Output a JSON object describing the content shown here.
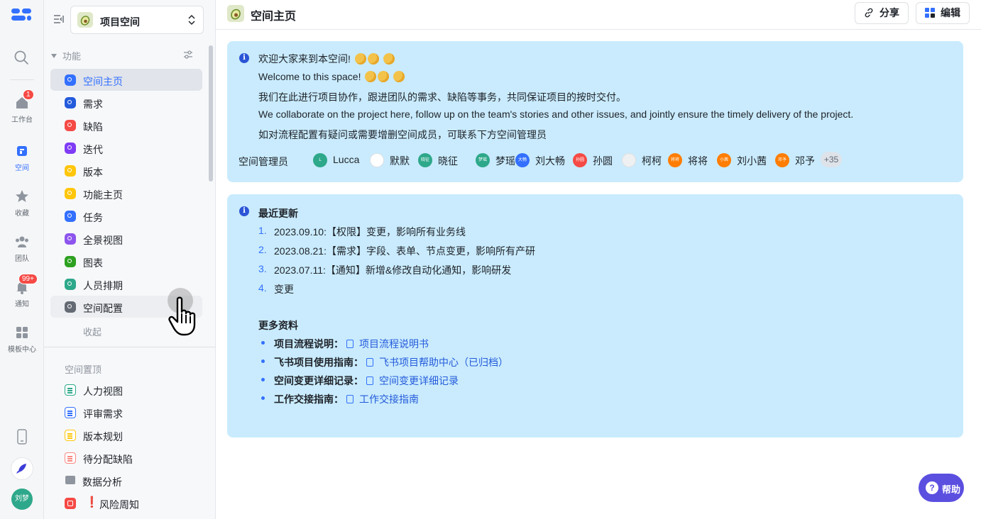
{
  "rail": {
    "items": [
      {
        "label": "工作台",
        "badge": "1"
      },
      {
        "label": "空间"
      },
      {
        "label": "收藏"
      },
      {
        "label": "团队"
      },
      {
        "label": "通知",
        "badge": "99+"
      },
      {
        "label": "模板中心"
      }
    ],
    "user_avatar": "刘梦"
  },
  "sidebar": {
    "space_name": "项目空间",
    "section_features": "功能",
    "items": [
      {
        "label": "空间主页",
        "color": "#3370ff"
      },
      {
        "label": "需求",
        "color": "#245bdb"
      },
      {
        "label": "缺陷",
        "color": "#f54a45"
      },
      {
        "label": "迭代",
        "color": "#7f3bf5"
      },
      {
        "label": "版本",
        "color": "#ffc60a"
      },
      {
        "label": "功能主页",
        "color": "#ffc60a"
      },
      {
        "label": "任务",
        "color": "#3370ff"
      },
      {
        "label": "全景视图",
        "color": "#8d55ed"
      },
      {
        "label": "图表",
        "color": "#2ea121"
      },
      {
        "label": "人员排期",
        "color": "#2ea88a"
      },
      {
        "label": "空间配置",
        "color": "#646a73"
      }
    ],
    "collapse": "收起",
    "section_pinned": "空间置顶",
    "pinned": [
      {
        "label": "人力视图",
        "color": "#2ea88a"
      },
      {
        "label": "评审需求",
        "color": "#3370ff"
      },
      {
        "label": "版本规划",
        "color": "#ffc60a"
      },
      {
        "label": "待分配缺陷",
        "color": "#f98981"
      }
    ],
    "data_analysis": "数据分析",
    "risk_bang": "❗",
    "risk": "风险周知"
  },
  "header": {
    "title": "空间主页",
    "share": "分享",
    "edit": "编辑"
  },
  "welcome": {
    "line1": "欢迎大家来到本空间!",
    "line2": "Welcome to this space!",
    "line3": "我们在此进行项目协作，跟进团队的需求、缺陷等事务，共同保证项目的按时交付。",
    "line4": "We collaborate on the project here, follow up on the team's stories and other issues, and jointly ensure the timely delivery of the project.",
    "line5": "如对流程配置有疑问或需要增删空间成员，可联系下方空间管理员",
    "admins_label": "空间管理员",
    "admins": [
      {
        "name": "Lucca",
        "initial": "L",
        "color": "#2ea88a"
      },
      {
        "name": "默默",
        "initial": "",
        "color": "#ffffff"
      },
      {
        "name": "晓征",
        "initial": "晓征",
        "color": "#2ea88a"
      },
      {
        "name": "梦瑶",
        "initial": "梦瑶",
        "color": "#2ea88a"
      },
      {
        "name": "刘大畅",
        "initial": "大畅",
        "color": "#3370ff"
      },
      {
        "name": "孙圆",
        "initial": "孙圆",
        "color": "#f54a45"
      },
      {
        "name": "柯柯",
        "initial": "",
        "color": "#eef0f2"
      },
      {
        "name": "将将",
        "initial": "将将",
        "color": "#ff7d00"
      },
      {
        "name": "刘小茜",
        "initial": "小茜",
        "color": "#ff7d00"
      },
      {
        "name": "邓予",
        "initial": "邓予",
        "color": "#ff7d00"
      }
    ],
    "admins_more": "+35"
  },
  "updates": {
    "title": "最近更新",
    "items": [
      {
        "num": "1.",
        "text": "2023.09.10:【权限】变更，影响所有业务线"
      },
      {
        "num": "2.",
        "text": "2023.08.21:【需求】字段、表单、节点变更，影响所有产研"
      },
      {
        "num": "3.",
        "text": "2023.07.11:【通知】新增&修改自动化通知，影响研发"
      },
      {
        "num": "4.",
        "text": "变更"
      }
    ],
    "more_title": "更多资料",
    "links": [
      {
        "label": "项目流程说明：",
        "link": "项目流程说明书"
      },
      {
        "label": "飞书项目使用指南：",
        "link": "飞书项目帮助中心（已归档）"
      },
      {
        "label": "空间变更详细记录：",
        "link": "空间变更详细记录"
      },
      {
        "label": "工作交接指南：",
        "link": "工作交接指南"
      }
    ]
  },
  "help": {
    "label": "帮助",
    "icon": "?"
  }
}
